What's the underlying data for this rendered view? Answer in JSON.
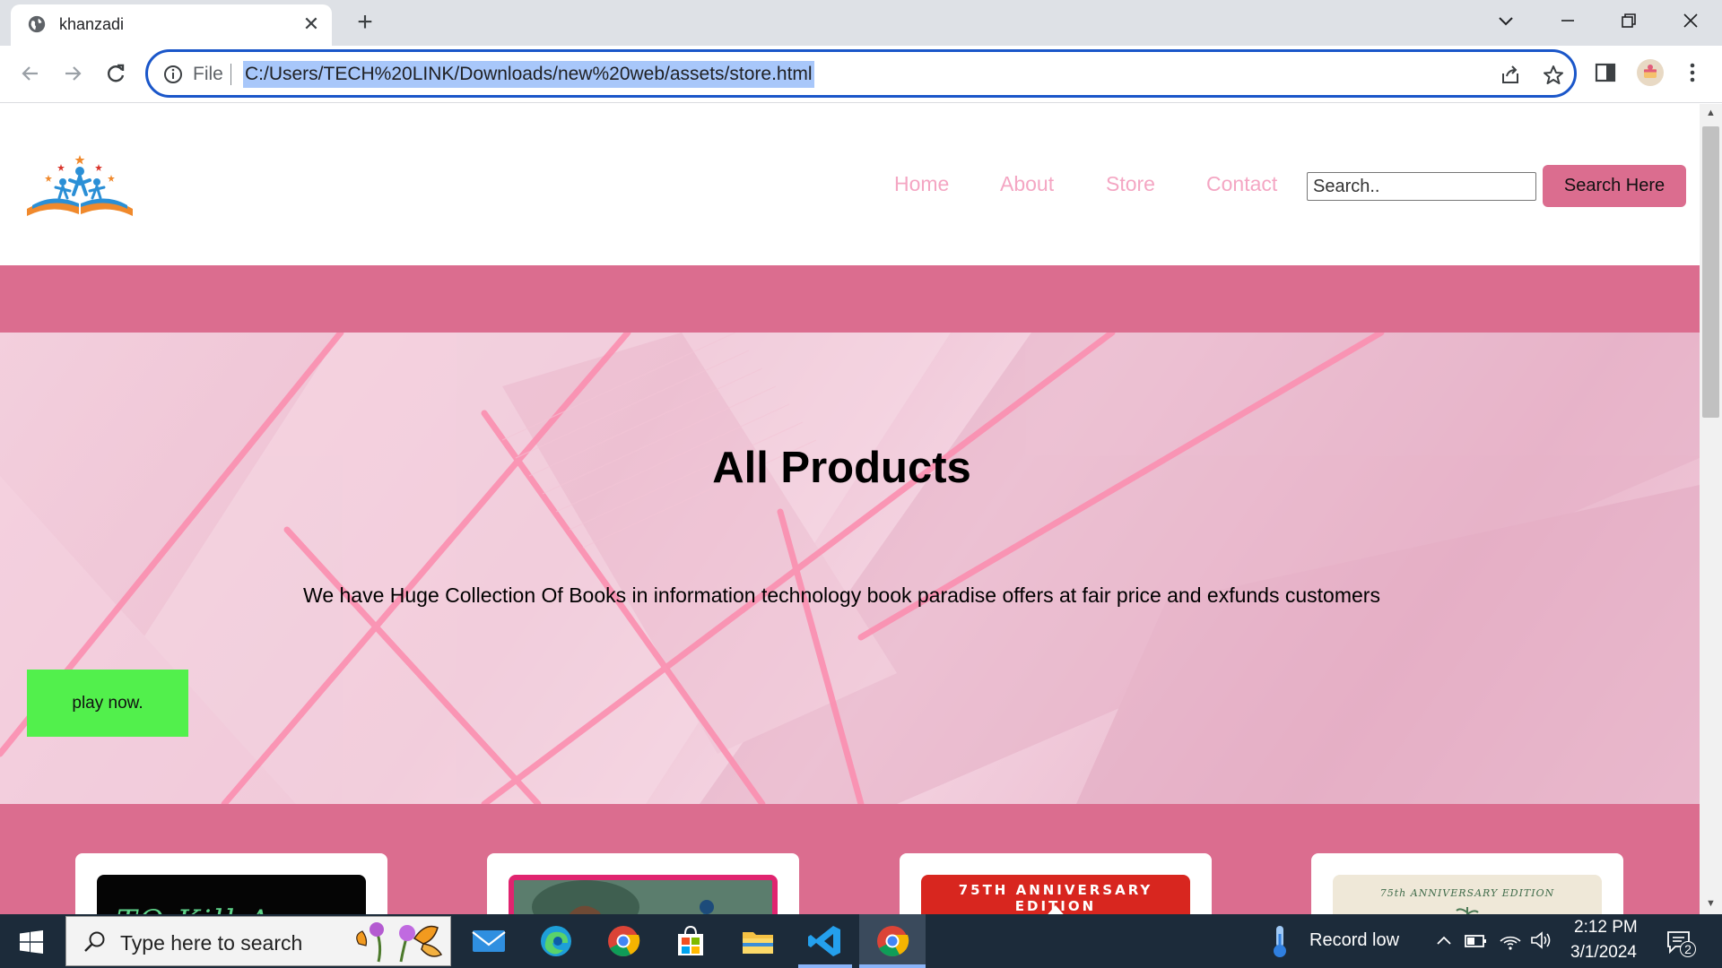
{
  "browser": {
    "tab_title": "khanzadi",
    "file_label": "File",
    "url": "C:/Users/TECH%20LINK/Downloads/new%20web/assets/store.html"
  },
  "site": {
    "nav": {
      "home": "Home",
      "about": "About",
      "store": "Store",
      "contact": "Contact"
    },
    "search": {
      "placeholder": "Search..",
      "button_label": "Search Here"
    },
    "hero": {
      "title": "All Products",
      "text": "We have Huge Collection Of Books in information technology book paradise offers at fair price and exfunds customers",
      "button_label": "play now."
    },
    "cards": [
      {
        "cover_text": "TO Kill A"
      },
      {
        "cover_text": ""
      },
      {
        "cover_text": "75TH ANNIVERSARY EDITION"
      },
      {
        "cover_text": "75th ANNIVERSARY EDITION"
      }
    ]
  },
  "taskbar": {
    "search_placeholder": "Type here to search",
    "weather": "Record low",
    "time": "2:12 PM",
    "date": "3/1/2024",
    "notification_count": "2"
  },
  "colors": {
    "accent_pink": "#db6d8f",
    "nav_link": "#f4a6c3",
    "play_button": "#52f04c",
    "omnibox_focus": "#1a56c9"
  }
}
